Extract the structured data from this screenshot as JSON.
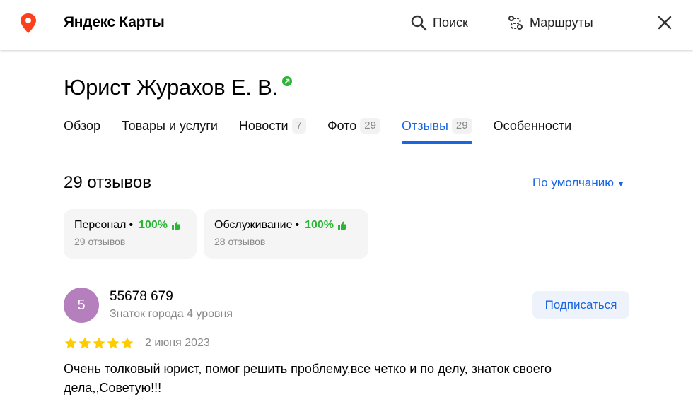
{
  "header": {
    "brand": "Яндекс Карты",
    "search_label": "Поиск",
    "routes_label": "Маршруты",
    "accent_color": "#fc3f1d"
  },
  "org": {
    "title": "Юрист Журахов Е. В.",
    "verified_icon": "verified-badge-icon"
  },
  "tabs": [
    {
      "label": "Обзор",
      "count": ""
    },
    {
      "label": "Товары и услуги",
      "count": ""
    },
    {
      "label": "Новости",
      "count": "7"
    },
    {
      "label": "Фото",
      "count": "29"
    },
    {
      "label": "Отзывы",
      "count": "29",
      "active": true
    },
    {
      "label": "Особенности",
      "count": ""
    }
  ],
  "reviews": {
    "count_label": "29 отзывов",
    "sort_label": "По умолчанию",
    "aspects": [
      {
        "name": "Персонал",
        "percent": "100%",
        "sub": "29 отзывов"
      },
      {
        "name": "Обслуживание",
        "percent": "100%",
        "sub": "28 отзывов"
      }
    ],
    "items": [
      {
        "avatar_letter": "5",
        "author": "55678 679",
        "level": "Знаток города 4 уровня",
        "subscribe_label": "Подписаться",
        "rating": 5,
        "date": "2 июня 2023",
        "text": "Очень толковый юрист, помог решить проблему,все четко и по делу, знаток своего дела,,Советую!!!"
      }
    ]
  },
  "colors": {
    "link_blue": "#1a66e0",
    "positive_green": "#2bb535",
    "star_yellow": "#fc0",
    "avatar_purple": "#b57fbd"
  }
}
